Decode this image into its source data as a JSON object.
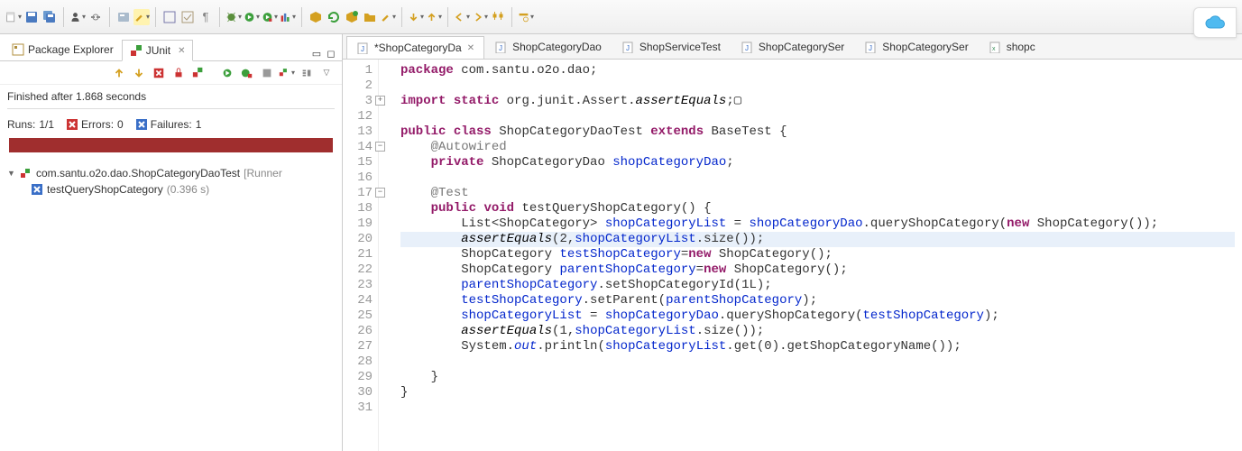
{
  "toolbar": {
    "items": [
      "new-wizard",
      "save",
      "save-all",
      "user",
      "sync",
      "new-project",
      "paint",
      "box1",
      "box2",
      "paragraph",
      "debug",
      "run",
      "run-ext",
      "package",
      "new-package",
      "refresh",
      "open-type",
      "open-folder",
      "edit",
      "step-down",
      "step-up",
      "back",
      "forward",
      "home",
      "search"
    ]
  },
  "views": {
    "pkgExplorer": "Package Explorer",
    "junit": "JUnit"
  },
  "junit": {
    "status": "Finished after 1.868 seconds",
    "runsLabel": "Runs:",
    "runsVal": "1/1",
    "errorsLabel": "Errors:",
    "errorsVal": "0",
    "failuresLabel": "Failures:",
    "failuresVal": "1",
    "tree": {
      "root": "com.santu.o2o.dao.ShopCategoryDaoTest",
      "rootSuffix": "[Runner",
      "child": "testQueryShopCategory",
      "childTime": "(0.396 s)"
    }
  },
  "editor": {
    "tabs": [
      {
        "label": "*ShopCategoryDa",
        "active": true,
        "kind": "java"
      },
      {
        "label": "ShopCategoryDao",
        "kind": "java"
      },
      {
        "label": "ShopServiceTest",
        "kind": "java"
      },
      {
        "label": "ShopCategorySer",
        "kind": "java"
      },
      {
        "label": "ShopCategorySer",
        "kind": "java"
      },
      {
        "label": "shopc",
        "kind": "xml"
      }
    ],
    "lines": [
      {
        "n": 1,
        "html": "<span class='kw'>package</span> com.santu.o2o.dao;"
      },
      {
        "n": 2,
        "html": ""
      },
      {
        "n": 3,
        "fold": "+",
        "html": "<span class='kw'>import</span> <span class='kw'>static</span> org.junit.Assert.<span class='static-m'>assertEquals</span>;▢"
      },
      {
        "n": 12,
        "html": ""
      },
      {
        "n": 13,
        "html": "<span class='kw'>public</span> <span class='kw'>class</span> ShopCategoryDaoTest <span class='kw'>extends</span> BaseTest {"
      },
      {
        "n": 14,
        "fold": "-",
        "html": "    <span class='anno'>@Autowired</span>"
      },
      {
        "n": 15,
        "html": "    <span class='kw'>private</span> ShopCategoryDao <span class='field'>shopCategoryDao</span>;"
      },
      {
        "n": 16,
        "html": ""
      },
      {
        "n": 17,
        "fold": "-",
        "html": "    <span class='anno'>@Test</span>"
      },
      {
        "n": 18,
        "html": "    <span class='kw'>public</span> <span class='kw'>void</span> testQueryShopCategory() {"
      },
      {
        "n": 19,
        "html": "        List&lt;ShopCategory&gt; <span class='field'>shopCategoryList</span> = <span class='field'>shopCategoryDao</span>.queryShopCategory(<span class='kw'>new</span> ShopCategory());"
      },
      {
        "n": 20,
        "hl": true,
        "html": "        <span class='static-m'>assertEquals</span>(2,<span class='field'>shopCategoryList</span>.size());"
      },
      {
        "n": 21,
        "html": "        ShopCategory <span class='field'>testShopCategory</span>=<span class='kw'>new</span> ShopCategory();"
      },
      {
        "n": 22,
        "html": "        ShopCategory <span class='field'>parentShopCategory</span>=<span class='kw'>new</span> ShopCategory();"
      },
      {
        "n": 23,
        "html": "        <span class='field'>parentShopCategory</span>.setShopCategoryId(1L);"
      },
      {
        "n": 24,
        "html": "        <span class='field'>testShopCategory</span>.setParent(<span class='field'>parentShopCategory</span>);"
      },
      {
        "n": 25,
        "html": "        <span class='field'>shopCategoryList</span> = <span class='field'>shopCategoryDao</span>.queryShopCategory(<span class='field'>testShopCategory</span>);"
      },
      {
        "n": 26,
        "html": "        <span class='static-m'>assertEquals</span>(1,<span class='field'>shopCategoryList</span>.size());"
      },
      {
        "n": 27,
        "html": "        System.<span class='field italic'>out</span>.println(<span class='field'>shopCategoryList</span>.get(0).getShopCategoryName());"
      },
      {
        "n": 28,
        "html": ""
      },
      {
        "n": 29,
        "html": "    }"
      },
      {
        "n": 30,
        "html": "}"
      },
      {
        "n": 31,
        "html": ""
      }
    ]
  }
}
